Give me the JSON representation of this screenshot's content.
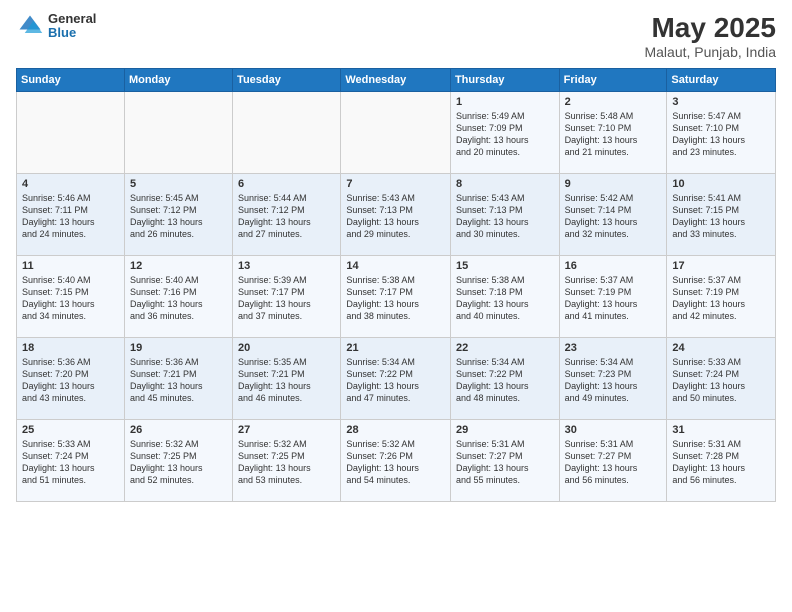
{
  "logo": {
    "general": "General",
    "blue": "Blue"
  },
  "header": {
    "title": "May 2025",
    "subtitle": "Malaut, Punjab, India"
  },
  "columns": [
    "Sunday",
    "Monday",
    "Tuesday",
    "Wednesday",
    "Thursday",
    "Friday",
    "Saturday"
  ],
  "weeks": [
    [
      {
        "day": "",
        "info": ""
      },
      {
        "day": "",
        "info": ""
      },
      {
        "day": "",
        "info": ""
      },
      {
        "day": "",
        "info": ""
      },
      {
        "day": "1",
        "info": "Sunrise: 5:49 AM\nSunset: 7:09 PM\nDaylight: 13 hours\nand 20 minutes."
      },
      {
        "day": "2",
        "info": "Sunrise: 5:48 AM\nSunset: 7:10 PM\nDaylight: 13 hours\nand 21 minutes."
      },
      {
        "day": "3",
        "info": "Sunrise: 5:47 AM\nSunset: 7:10 PM\nDaylight: 13 hours\nand 23 minutes."
      }
    ],
    [
      {
        "day": "4",
        "info": "Sunrise: 5:46 AM\nSunset: 7:11 PM\nDaylight: 13 hours\nand 24 minutes."
      },
      {
        "day": "5",
        "info": "Sunrise: 5:45 AM\nSunset: 7:12 PM\nDaylight: 13 hours\nand 26 minutes."
      },
      {
        "day": "6",
        "info": "Sunrise: 5:44 AM\nSunset: 7:12 PM\nDaylight: 13 hours\nand 27 minutes."
      },
      {
        "day": "7",
        "info": "Sunrise: 5:43 AM\nSunset: 7:13 PM\nDaylight: 13 hours\nand 29 minutes."
      },
      {
        "day": "8",
        "info": "Sunrise: 5:43 AM\nSunset: 7:13 PM\nDaylight: 13 hours\nand 30 minutes."
      },
      {
        "day": "9",
        "info": "Sunrise: 5:42 AM\nSunset: 7:14 PM\nDaylight: 13 hours\nand 32 minutes."
      },
      {
        "day": "10",
        "info": "Sunrise: 5:41 AM\nSunset: 7:15 PM\nDaylight: 13 hours\nand 33 minutes."
      }
    ],
    [
      {
        "day": "11",
        "info": "Sunrise: 5:40 AM\nSunset: 7:15 PM\nDaylight: 13 hours\nand 34 minutes."
      },
      {
        "day": "12",
        "info": "Sunrise: 5:40 AM\nSunset: 7:16 PM\nDaylight: 13 hours\nand 36 minutes."
      },
      {
        "day": "13",
        "info": "Sunrise: 5:39 AM\nSunset: 7:17 PM\nDaylight: 13 hours\nand 37 minutes."
      },
      {
        "day": "14",
        "info": "Sunrise: 5:38 AM\nSunset: 7:17 PM\nDaylight: 13 hours\nand 38 minutes."
      },
      {
        "day": "15",
        "info": "Sunrise: 5:38 AM\nSunset: 7:18 PM\nDaylight: 13 hours\nand 40 minutes."
      },
      {
        "day": "16",
        "info": "Sunrise: 5:37 AM\nSunset: 7:19 PM\nDaylight: 13 hours\nand 41 minutes."
      },
      {
        "day": "17",
        "info": "Sunrise: 5:37 AM\nSunset: 7:19 PM\nDaylight: 13 hours\nand 42 minutes."
      }
    ],
    [
      {
        "day": "18",
        "info": "Sunrise: 5:36 AM\nSunset: 7:20 PM\nDaylight: 13 hours\nand 43 minutes."
      },
      {
        "day": "19",
        "info": "Sunrise: 5:36 AM\nSunset: 7:21 PM\nDaylight: 13 hours\nand 45 minutes."
      },
      {
        "day": "20",
        "info": "Sunrise: 5:35 AM\nSunset: 7:21 PM\nDaylight: 13 hours\nand 46 minutes."
      },
      {
        "day": "21",
        "info": "Sunrise: 5:34 AM\nSunset: 7:22 PM\nDaylight: 13 hours\nand 47 minutes."
      },
      {
        "day": "22",
        "info": "Sunrise: 5:34 AM\nSunset: 7:22 PM\nDaylight: 13 hours\nand 48 minutes."
      },
      {
        "day": "23",
        "info": "Sunrise: 5:34 AM\nSunset: 7:23 PM\nDaylight: 13 hours\nand 49 minutes."
      },
      {
        "day": "24",
        "info": "Sunrise: 5:33 AM\nSunset: 7:24 PM\nDaylight: 13 hours\nand 50 minutes."
      }
    ],
    [
      {
        "day": "25",
        "info": "Sunrise: 5:33 AM\nSunset: 7:24 PM\nDaylight: 13 hours\nand 51 minutes."
      },
      {
        "day": "26",
        "info": "Sunrise: 5:32 AM\nSunset: 7:25 PM\nDaylight: 13 hours\nand 52 minutes."
      },
      {
        "day": "27",
        "info": "Sunrise: 5:32 AM\nSunset: 7:25 PM\nDaylight: 13 hours\nand 53 minutes."
      },
      {
        "day": "28",
        "info": "Sunrise: 5:32 AM\nSunset: 7:26 PM\nDaylight: 13 hours\nand 54 minutes."
      },
      {
        "day": "29",
        "info": "Sunrise: 5:31 AM\nSunset: 7:27 PM\nDaylight: 13 hours\nand 55 minutes."
      },
      {
        "day": "30",
        "info": "Sunrise: 5:31 AM\nSunset: 7:27 PM\nDaylight: 13 hours\nand 56 minutes."
      },
      {
        "day": "31",
        "info": "Sunrise: 5:31 AM\nSunset: 7:28 PM\nDaylight: 13 hours\nand 56 minutes."
      }
    ]
  ]
}
